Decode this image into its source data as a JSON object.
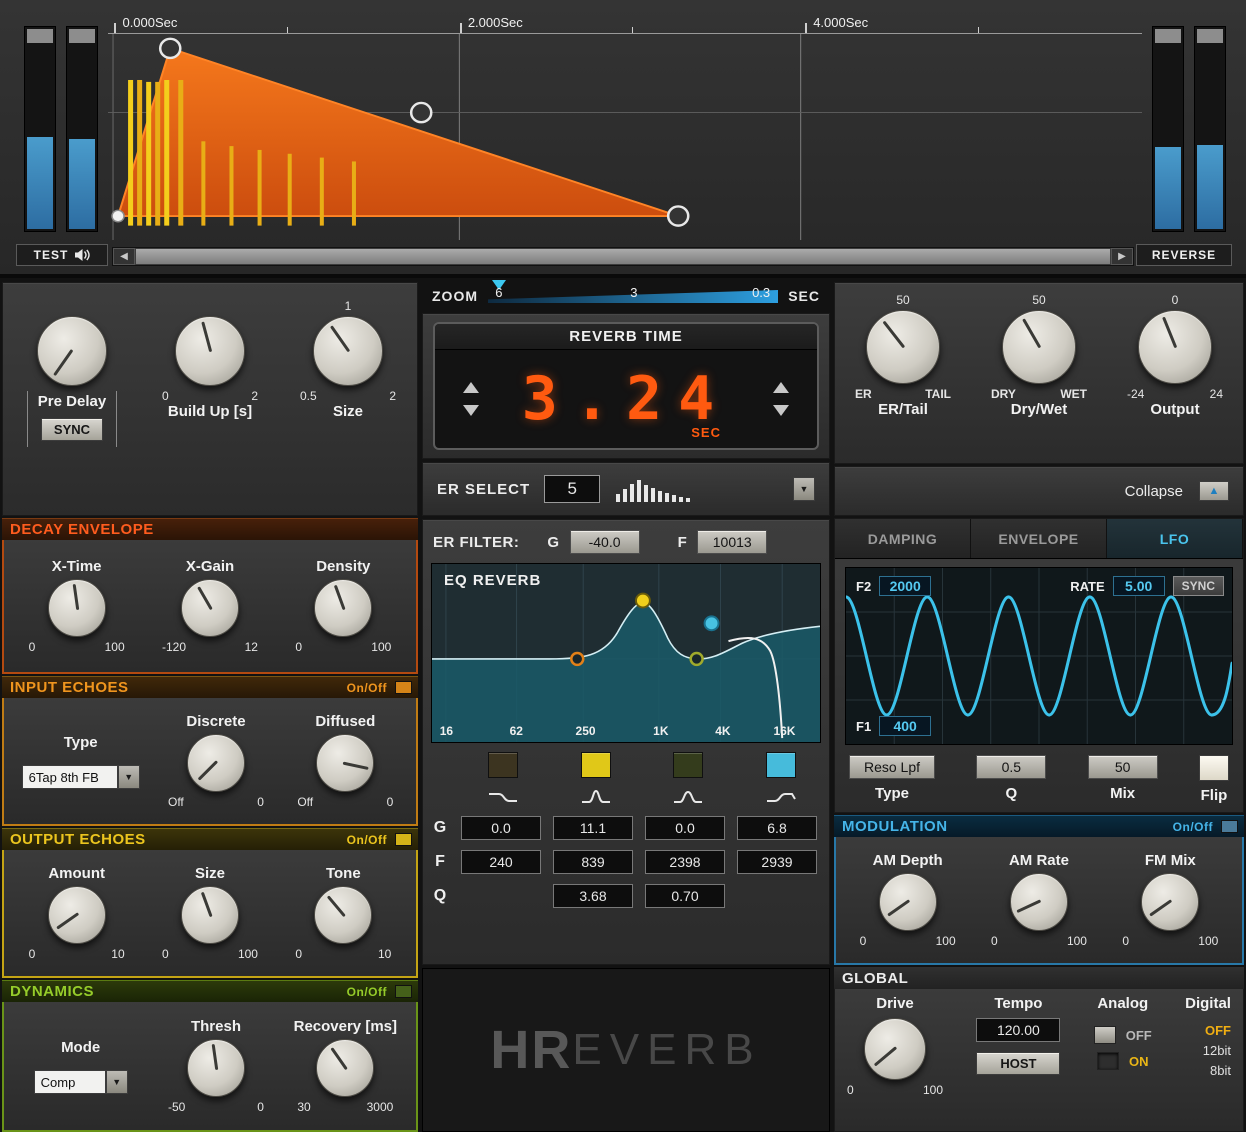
{
  "colors": {
    "accent_orange": "#ff5a10",
    "accent_yellow": "#e8c818",
    "accent_green": "#95cc2a",
    "accent_blue": "#48c0e8"
  },
  "envelope": {
    "time_labels": [
      "0.000Sec",
      "2.000Sec",
      "4.000Sec"
    ],
    "test_label": "TEST",
    "reverse_label": "REVERSE"
  },
  "zoom": {
    "label": "ZOOM",
    "t1": "6",
    "t2": "3",
    "t3": "0.3",
    "unit": "SEC"
  },
  "left": {
    "top": {
      "predelay_label": "Pre Delay",
      "sync_label": "SYNC",
      "buildup_label": "Build Up [s]",
      "buildup_min": "0",
      "buildup_max": "2",
      "size_label": "Size",
      "size_min": "0.5",
      "size_max": "2",
      "size_top": "1"
    },
    "decay": {
      "header": "DECAY ENVELOPE",
      "knobs": [
        {
          "label": "X-Time",
          "min": "0",
          "max": "100"
        },
        {
          "label": "X-Gain",
          "min": "-120",
          "max": "12"
        },
        {
          "label": "Density",
          "min": "0",
          "max": "100"
        }
      ]
    },
    "input_echoes": {
      "header": "INPUT ECHOES",
      "onoff": "On/Off",
      "type_label": "Type",
      "type_value": "6Tap 8th FB",
      "knobs": [
        {
          "label": "Discrete",
          "min": "Off",
          "max": "0"
        },
        {
          "label": "Diffused",
          "min": "Off",
          "max": "0"
        }
      ]
    },
    "output_echoes": {
      "header": "OUTPUT ECHOES",
      "onoff": "On/Off",
      "knobs": [
        {
          "label": "Amount",
          "min": "0",
          "max": "10"
        },
        {
          "label": "Size",
          "min": "0",
          "max": "100"
        },
        {
          "label": "Tone",
          "min": "0",
          "max": "10"
        }
      ]
    },
    "dynamics": {
      "header": "DYNAMICS",
      "onoff": "On/Off",
      "mode_label": "Mode",
      "mode_value": "Comp",
      "knobs": [
        {
          "label": "Thresh",
          "min": "-50",
          "max": "0"
        },
        {
          "label": "Recovery [ms]",
          "min": "30",
          "max": "3000"
        }
      ]
    }
  },
  "center": {
    "reverb_time": {
      "title": "REVERB TIME",
      "value": "3.24",
      "unit": "SEC"
    },
    "er_select": {
      "label": "ER SELECT",
      "value": "5"
    },
    "er_filter": {
      "label": "ER FILTER:",
      "g_label": "G",
      "g_value": "-40.0",
      "f_label": "F",
      "f_value": "10013"
    },
    "eq": {
      "title": "EQ REVERB",
      "freq_labels": [
        "16",
        "62",
        "250",
        "1K",
        "4K",
        "16K"
      ],
      "g_label": "G",
      "f_label": "F",
      "q_label": "Q",
      "g_values": [
        "0.0",
        "11.1",
        "0.0",
        "6.8"
      ],
      "f_values": [
        "240",
        "839",
        "2398",
        "2939"
      ],
      "q_values": [
        "3.68",
        "0.70"
      ],
      "band_colors": [
        "#3c3420",
        "#e0c818",
        "#343c1c",
        "#46bbdb"
      ]
    },
    "logo": {
      "part1": "HR",
      "part2": "EVERB"
    }
  },
  "right": {
    "top_knobs": [
      {
        "label": "ER/Tail",
        "min": "ER",
        "max": "TAIL",
        "top": "50"
      },
      {
        "label": "Dry/Wet",
        "min": "DRY",
        "max": "WET",
        "top": "50"
      },
      {
        "label": "Output",
        "min": "-24",
        "max": "24",
        "top": "0"
      }
    ],
    "collapse_label": "Collapse",
    "tabs": [
      "DAMPING",
      "ENVELOPE",
      "LFO"
    ],
    "lfo": {
      "f2_label": "F2",
      "f2_value": "2000",
      "rate_label": "RATE",
      "rate_value": "5.00",
      "sync_label": "SYNC",
      "f1_label": "F1",
      "f1_value": "400"
    },
    "filter_row": {
      "type_value": "Reso Lpf",
      "q_value": "0.5",
      "mix_value": "50",
      "type_label": "Type",
      "q_label": "Q",
      "mix_label": "Mix",
      "flip_label": "Flip"
    },
    "modulation": {
      "header": "MODULATION",
      "onoff": "On/Off",
      "knobs": [
        {
          "label": "AM Depth",
          "min": "0",
          "max": "100"
        },
        {
          "label": "AM Rate",
          "min": "0",
          "max": "100"
        },
        {
          "label": "FM Mix",
          "min": "0",
          "max": "100"
        }
      ]
    },
    "global": {
      "header": "GLOBAL",
      "drive_label": "Drive",
      "drive_min": "0",
      "drive_max": "100",
      "tempo_label": "Tempo",
      "tempo_value": "120.00",
      "host_label": "HOST",
      "analog_label": "Analog",
      "analog_off": "OFF",
      "analog_on": "ON",
      "digital_label": "Digital",
      "digital_options": [
        "OFF",
        "12bit",
        "8bit"
      ]
    }
  }
}
